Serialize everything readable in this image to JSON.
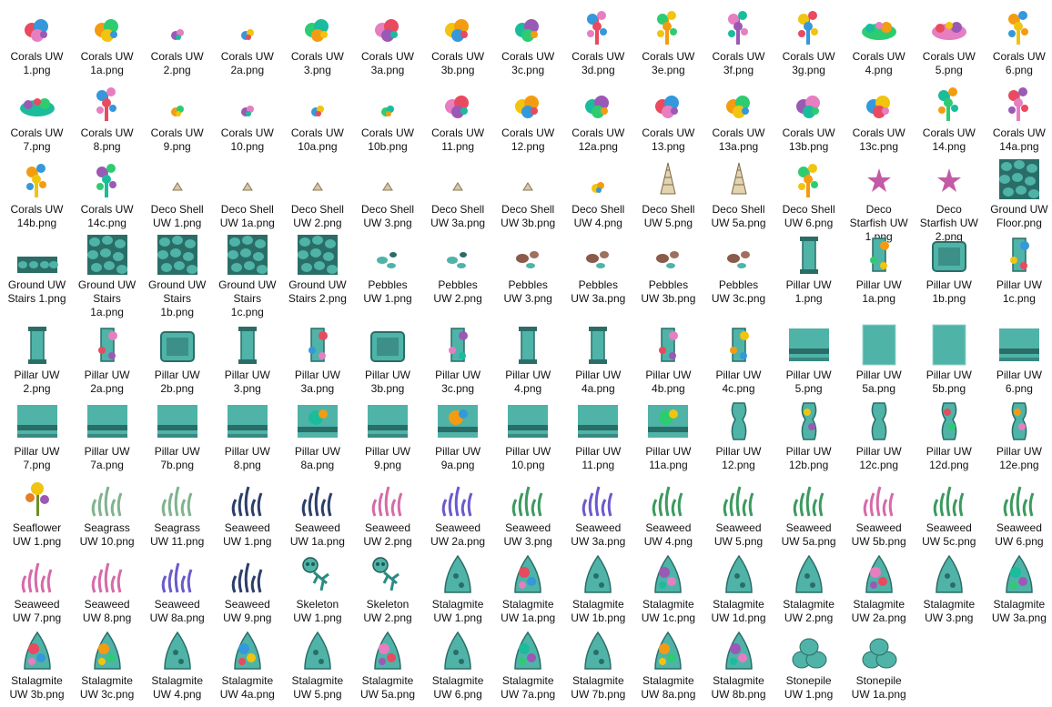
{
  "window": {
    "view": "Large icons"
  },
  "colors": {
    "background": "#ffffff",
    "label_text": "#111111",
    "stone": "#4fb3a8",
    "stone_dark": "#2a6d67",
    "coral_palette": [
      "#e84a5f",
      "#f39c12",
      "#9b59b6",
      "#3498db",
      "#2ecc71",
      "#e67ec1",
      "#f1c40f",
      "#1abc9c"
    ]
  },
  "files": [
    {
      "label": "Corals UW\n1.png",
      "icon": "coral-icon"
    },
    {
      "label": "Corals UW\n1a.png",
      "icon": "coral-icon"
    },
    {
      "label": "Corals UW\n2.png",
      "icon": "coral-small-icon"
    },
    {
      "label": "Corals UW\n2a.png",
      "icon": "coral-small-icon"
    },
    {
      "label": "Corals UW\n3.png",
      "icon": "coral-icon"
    },
    {
      "label": "Corals UW\n3a.png",
      "icon": "coral-icon"
    },
    {
      "label": "Corals UW\n3b.png",
      "icon": "coral-icon"
    },
    {
      "label": "Corals UW\n3c.png",
      "icon": "coral-icon"
    },
    {
      "label": "Corals UW\n3d.png",
      "icon": "coral-tall-icon"
    },
    {
      "label": "Corals UW\n3e.png",
      "icon": "coral-tall-icon"
    },
    {
      "label": "Corals UW\n3f.png",
      "icon": "coral-tall-icon"
    },
    {
      "label": "Corals UW\n3g.png",
      "icon": "coral-tall-icon"
    },
    {
      "label": "Corals UW\n4.png",
      "icon": "coral-wide-icon"
    },
    {
      "label": "Corals UW\n5.png",
      "icon": "coral-wide-icon"
    },
    {
      "label": "Corals UW\n6.png",
      "icon": "coral-tall-icon"
    },
    {
      "label": "Corals UW\n7.png",
      "icon": "coral-wide-icon"
    },
    {
      "label": "Corals UW\n8.png",
      "icon": "coral-tall-icon"
    },
    {
      "label": "Corals UW\n9.png",
      "icon": "coral-small-icon"
    },
    {
      "label": "Corals UW\n10.png",
      "icon": "coral-small-icon"
    },
    {
      "label": "Corals UW\n10a.png",
      "icon": "coral-small-icon"
    },
    {
      "label": "Corals UW\n10b.png",
      "icon": "coral-small-icon"
    },
    {
      "label": "Corals UW\n11.png",
      "icon": "coral-icon"
    },
    {
      "label": "Corals UW\n12.png",
      "icon": "coral-icon"
    },
    {
      "label": "Corals UW\n12a.png",
      "icon": "coral-icon"
    },
    {
      "label": "Corals UW\n13.png",
      "icon": "coral-icon"
    },
    {
      "label": "Corals UW\n13a.png",
      "icon": "coral-icon"
    },
    {
      "label": "Corals UW\n13b.png",
      "icon": "coral-icon"
    },
    {
      "label": "Corals UW\n13c.png",
      "icon": "coral-icon"
    },
    {
      "label": "Corals UW\n14.png",
      "icon": "coral-tall-icon"
    },
    {
      "label": "Corals UW\n14a.png",
      "icon": "coral-tall-icon"
    },
    {
      "label": "Corals UW\n14b.png",
      "icon": "coral-tall-icon"
    },
    {
      "label": "Corals UW\n14c.png",
      "icon": "coral-tall-icon"
    },
    {
      "label": "Deco Shell\nUW 1.png",
      "icon": "shell-icon"
    },
    {
      "label": "Deco Shell\nUW 1a.png",
      "icon": "shell-icon"
    },
    {
      "label": "Deco Shell\nUW 2.png",
      "icon": "shell-icon"
    },
    {
      "label": "Deco Shell\nUW 3.png",
      "icon": "shell-icon"
    },
    {
      "label": "Deco Shell\nUW 3a.png",
      "icon": "shell-icon"
    },
    {
      "label": "Deco Shell\nUW 3b.png",
      "icon": "shell-icon"
    },
    {
      "label": "Deco Shell\nUW 4.png",
      "icon": "coral-small-icon"
    },
    {
      "label": "Deco Shell\nUW 5.png",
      "icon": "conch-icon"
    },
    {
      "label": "Deco Shell\nUW 5a.png",
      "icon": "conch-icon"
    },
    {
      "label": "Deco Shell\nUW 6.png",
      "icon": "coral-tall-icon"
    },
    {
      "label": "Deco\nStarfish UW\n1.png",
      "icon": "starfish-icon"
    },
    {
      "label": "Deco\nStarfish UW\n2.png",
      "icon": "starfish-icon"
    },
    {
      "label": "Ground UW\nFloor.png",
      "icon": "ground-tile-icon"
    },
    {
      "label": "Ground UW\nStairs 1.png",
      "icon": "ground-strip-icon"
    },
    {
      "label": "Ground UW\nStairs\n1a.png",
      "icon": "ground-tile-icon"
    },
    {
      "label": "Ground UW\nStairs\n1b.png",
      "icon": "ground-tile-icon"
    },
    {
      "label": "Ground UW\nStairs\n1c.png",
      "icon": "ground-tile-icon"
    },
    {
      "label": "Ground UW\nStairs 2.png",
      "icon": "ground-tile-icon"
    },
    {
      "label": "Pebbles\nUW 1.png",
      "icon": "pebbles-icon"
    },
    {
      "label": "Pebbles\nUW 2.png",
      "icon": "pebbles-icon"
    },
    {
      "label": "Pebbles\nUW 3.png",
      "icon": "pebbles-brown-icon"
    },
    {
      "label": "Pebbles\nUW 3a.png",
      "icon": "pebbles-brown-icon"
    },
    {
      "label": "Pebbles\nUW 3b.png",
      "icon": "pebbles-brown-icon"
    },
    {
      "label": "Pebbles\nUW 3c.png",
      "icon": "pebbles-brown-icon"
    },
    {
      "label": "Pillar UW\n1.png",
      "icon": "pillar-icon"
    },
    {
      "label": "Pillar UW\n1a.png",
      "icon": "pillar-coral-icon"
    },
    {
      "label": "Pillar UW\n1b.png",
      "icon": "pillar-block-icon"
    },
    {
      "label": "Pillar UW\n1c.png",
      "icon": "pillar-coral-icon"
    },
    {
      "label": "Pillar UW\n2.png",
      "icon": "pillar-icon"
    },
    {
      "label": "Pillar UW\n2a.png",
      "icon": "pillar-coral-icon"
    },
    {
      "label": "Pillar UW\n2b.png",
      "icon": "pillar-block-icon"
    },
    {
      "label": "Pillar UW\n3.png",
      "icon": "pillar-icon"
    },
    {
      "label": "Pillar UW\n3a.png",
      "icon": "pillar-coral-icon"
    },
    {
      "label": "Pillar UW\n3b.png",
      "icon": "pillar-block-icon"
    },
    {
      "label": "Pillar UW\n3c.png",
      "icon": "pillar-coral-icon"
    },
    {
      "label": "Pillar UW\n4.png",
      "icon": "pillar-icon"
    },
    {
      "label": "Pillar UW\n4a.png",
      "icon": "pillar-icon"
    },
    {
      "label": "Pillar UW\n4b.png",
      "icon": "pillar-coral-icon"
    },
    {
      "label": "Pillar UW\n4c.png",
      "icon": "pillar-coral-icon"
    },
    {
      "label": "Pillar UW\n5.png",
      "icon": "wall-tile-icon"
    },
    {
      "label": "Pillar UW\n5a.png",
      "icon": "wall-plain-icon"
    },
    {
      "label": "Pillar UW\n5b.png",
      "icon": "wall-plain-icon"
    },
    {
      "label": "Pillar UW\n6.png",
      "icon": "wall-tile-icon"
    },
    {
      "label": "Pillar UW\n7.png",
      "icon": "wall-tile-icon"
    },
    {
      "label": "Pillar UW\n7a.png",
      "icon": "wall-tile-icon"
    },
    {
      "label": "Pillar UW\n7b.png",
      "icon": "wall-tile-icon"
    },
    {
      "label": "Pillar UW\n8.png",
      "icon": "wall-tile-icon"
    },
    {
      "label": "Pillar UW\n8a.png",
      "icon": "wall-coral-icon"
    },
    {
      "label": "Pillar UW\n9.png",
      "icon": "wall-tile-icon"
    },
    {
      "label": "Pillar UW\n9a.png",
      "icon": "wall-coral-icon"
    },
    {
      "label": "Pillar UW\n10.png",
      "icon": "wall-tile-icon"
    },
    {
      "label": "Pillar UW\n11.png",
      "icon": "wall-tile-icon"
    },
    {
      "label": "Pillar UW\n11a.png",
      "icon": "wall-coral-icon"
    },
    {
      "label": "Pillar UW\n12.png",
      "icon": "column-icon"
    },
    {
      "label": "Pillar UW\n12b.png",
      "icon": "column-coral-icon"
    },
    {
      "label": "Pillar UW\n12c.png",
      "icon": "column-icon"
    },
    {
      "label": "Pillar UW\n12d.png",
      "icon": "column-coral-icon"
    },
    {
      "label": "Pillar UW\n12e.png",
      "icon": "column-coral-icon"
    },
    {
      "label": "Seaflower\nUW 1.png",
      "icon": "seaflower-icon"
    },
    {
      "label": "Seagrass\nUW 10.png",
      "icon": "seagrass-icon"
    },
    {
      "label": "Seagrass\nUW 11.png",
      "icon": "seagrass-icon"
    },
    {
      "label": "Seaweed\nUW 1.png",
      "icon": "seaweed-dark-icon"
    },
    {
      "label": "Seaweed\nUW 1a.png",
      "icon": "seaweed-dark-icon"
    },
    {
      "label": "Seaweed\nUW 2.png",
      "icon": "seaweed-pink-icon"
    },
    {
      "label": "Seaweed\nUW 2a.png",
      "icon": "seaweed-purple-icon"
    },
    {
      "label": "Seaweed\nUW 3.png",
      "icon": "seaweed-green-icon"
    },
    {
      "label": "Seaweed\nUW 3a.png",
      "icon": "seaweed-purple-icon"
    },
    {
      "label": "Seaweed\nUW 4.png",
      "icon": "seaweed-green-icon"
    },
    {
      "label": "Seaweed\nUW 5.png",
      "icon": "seaweed-green-icon"
    },
    {
      "label": "Seaweed\nUW 5a.png",
      "icon": "seaweed-green-icon"
    },
    {
      "label": "Seaweed\nUW 5b.png",
      "icon": "seaweed-pink-icon"
    },
    {
      "label": "Seaweed\nUW 5c.png",
      "icon": "seaweed-green-icon"
    },
    {
      "label": "Seaweed\nUW 6.png",
      "icon": "seaweed-green-icon"
    },
    {
      "label": "Seaweed\nUW 7.png",
      "icon": "seaweed-pink-icon"
    },
    {
      "label": "Seaweed\nUW 8.png",
      "icon": "seaweed-pink-icon"
    },
    {
      "label": "Seaweed\nUW 8a.png",
      "icon": "seaweed-purple-icon"
    },
    {
      "label": "Seaweed\nUW 9.png",
      "icon": "seaweed-dark-icon"
    },
    {
      "label": "Skeleton\nUW 1.png",
      "icon": "skeleton-icon"
    },
    {
      "label": "Skeleton\nUW 2.png",
      "icon": "skeleton-icon"
    },
    {
      "label": "Stalagmite\nUW 1.png",
      "icon": "stalagmite-icon"
    },
    {
      "label": "Stalagmite\nUW 1a.png",
      "icon": "stalagmite-coral-icon"
    },
    {
      "label": "Stalagmite\nUW 1b.png",
      "icon": "stalagmite-icon"
    },
    {
      "label": "Stalagmite\nUW 1c.png",
      "icon": "stalagmite-coral-icon"
    },
    {
      "label": "Stalagmite\nUW 1d.png",
      "icon": "stalagmite-icon"
    },
    {
      "label": "Stalagmite\nUW 2.png",
      "icon": "stalagmite-icon"
    },
    {
      "label": "Stalagmite\nUW 2a.png",
      "icon": "stalagmite-coral-icon"
    },
    {
      "label": "Stalagmite\nUW 3.png",
      "icon": "stalagmite-icon"
    },
    {
      "label": "Stalagmite\nUW 3a.png",
      "icon": "stalagmite-coral-icon"
    },
    {
      "label": "Stalagmite\nUW 3b.png",
      "icon": "stalagmite-coral-icon"
    },
    {
      "label": "Stalagmite\nUW 3c.png",
      "icon": "stalagmite-coral-icon"
    },
    {
      "label": "Stalagmite\nUW 4.png",
      "icon": "stalagmite-icon"
    },
    {
      "label": "Stalagmite\nUW 4a.png",
      "icon": "stalagmite-coral-icon"
    },
    {
      "label": "Stalagmite\nUW 5.png",
      "icon": "stalagmite-icon"
    },
    {
      "label": "Stalagmite\nUW 5a.png",
      "icon": "stalagmite-coral-icon"
    },
    {
      "label": "Stalagmite\nUW 6.png",
      "icon": "stalagmite-icon"
    },
    {
      "label": "Stalagmite\nUW 7a.png",
      "icon": "stalagmite-coral-icon"
    },
    {
      "label": "Stalagmite\nUW 7b.png",
      "icon": "stalagmite-icon"
    },
    {
      "label": "Stalagmite\nUW 8a.png",
      "icon": "stalagmite-coral-icon"
    },
    {
      "label": "Stalagmite\nUW 8b.png",
      "icon": "stalagmite-coral-icon"
    },
    {
      "label": "Stonepile\nUW 1.png",
      "icon": "stonepile-icon"
    },
    {
      "label": "Stonepile\nUW 1a.png",
      "icon": "stonepile-icon"
    }
  ]
}
